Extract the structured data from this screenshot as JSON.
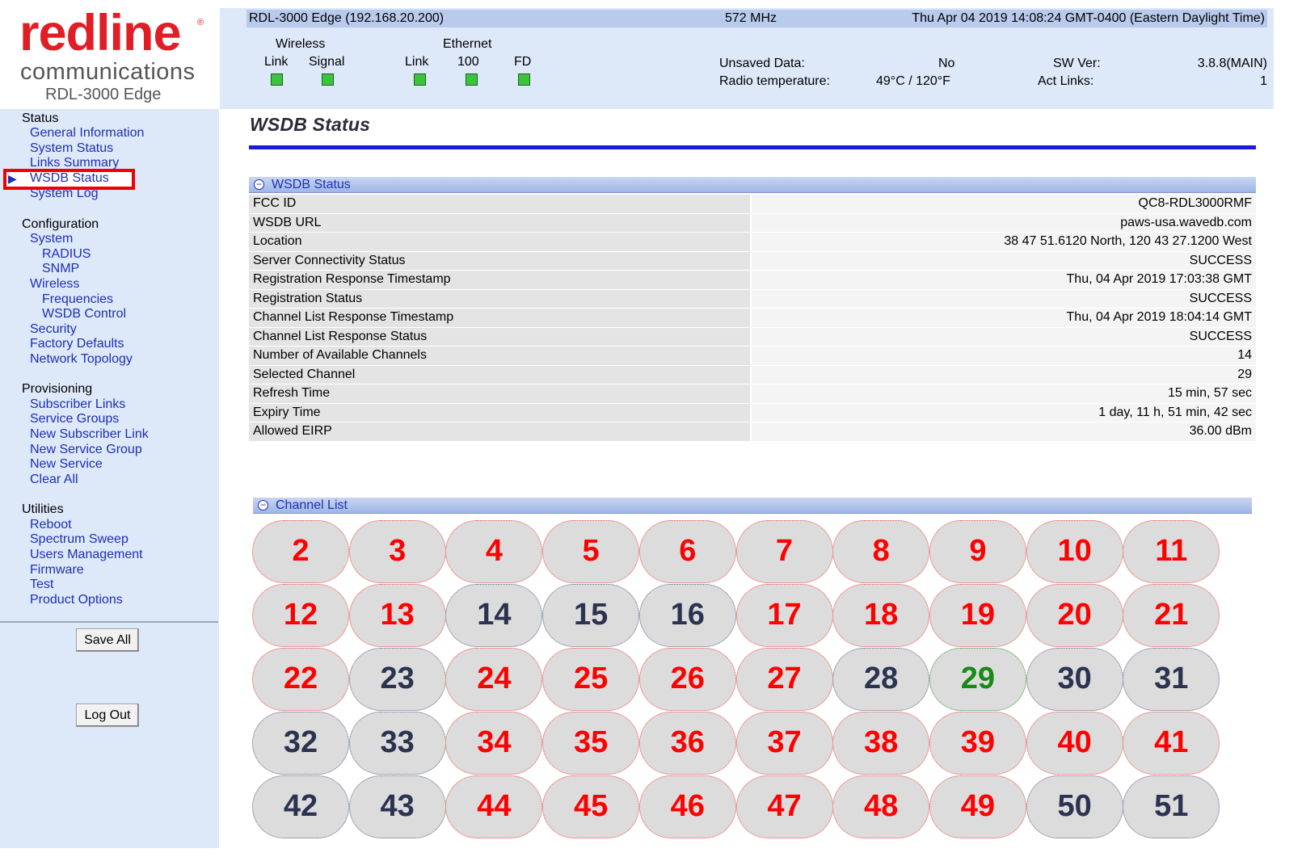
{
  "logo": {
    "word": "redline",
    "reg": "®",
    "sub": "communications",
    "model": "RDL-3000 Edge"
  },
  "header": {
    "device": "RDL-3000 Edge (192.168.20.200)",
    "frequency": "572 MHz",
    "datetime": "Thu Apr 04 2019 14:08:24 GMT-0400 (Eastern Daylight Time)",
    "wireless_label": "Wireless",
    "ethernet_label": "Ethernet",
    "leds": [
      "Link",
      "Signal",
      "Link",
      "100",
      "FD"
    ],
    "unsaved_label": "Unsaved Data:",
    "unsaved_value": "No",
    "temp_label": "Radio temperature:",
    "temp_value": "49°C / 120°F",
    "swver_label": "SW Ver:",
    "swver_value": "3.8.8(MAIN)",
    "actlinks_label": "Act Links:",
    "actlinks_value": "1",
    "led_color": "#3cc43c"
  },
  "nav": {
    "status": "Status",
    "general_info": "General Information",
    "system_status": "System Status",
    "links_summary": "Links Summary",
    "wsdb_status": "WSDB Status",
    "system_log": "System Log",
    "configuration": "Configuration",
    "system": "System",
    "radius": "RADIUS",
    "snmp": "SNMP",
    "wireless": "Wireless",
    "frequencies": "Frequencies",
    "wsdb_control": "WSDB Control",
    "security": "Security",
    "factory_defaults": "Factory Defaults",
    "network_topology": "Network Topology",
    "provisioning": "Provisioning",
    "subscriber_links": "Subscriber Links",
    "service_groups": "Service Groups",
    "new_subscriber_link": "New Subscriber Link",
    "new_service_group": "New Service Group",
    "new_service": "New Service",
    "clear_all": "Clear All",
    "utilities": "Utilities",
    "reboot": "Reboot",
    "spectrum_sweep": "Spectrum Sweep",
    "users_management": "Users Management",
    "firmware": "Firmware",
    "test": "Test",
    "product_options": "Product Options",
    "save_all": "Save All",
    "log_out": "Log Out",
    "active_marker": "▶",
    "active_border_color": "#f00000",
    "link_color": "#1d2fb8"
  },
  "main": {
    "title": "WSDB Status",
    "wsdb_panel_title": "WSDB Status",
    "toggle_symbol": "−",
    "rows": [
      {
        "key": "FCC ID",
        "value": "QC8-RDL3000RMF"
      },
      {
        "key": "WSDB URL",
        "value": "paws-usa.wavedb.com"
      },
      {
        "key": "Location",
        "value": "38 47 51.6120 North, 120 43 27.1200 West"
      },
      {
        "key": "Server Connectivity Status",
        "value": "SUCCESS"
      },
      {
        "key": "Registration Response Timestamp",
        "value": "Thu, 04 Apr 2019 17:03:38 GMT"
      },
      {
        "key": "Registration Status",
        "value": "SUCCESS"
      },
      {
        "key": "Channel List Response Timestamp",
        "value": "Thu, 04 Apr 2019 18:04:14 GMT"
      },
      {
        "key": "Channel List Response Status",
        "value": "SUCCESS"
      },
      {
        "key": "Number of Available Channels",
        "value": "14"
      },
      {
        "key": "Selected Channel",
        "value": "29"
      },
      {
        "key": "Refresh Time",
        "value": "15 min, 57 sec"
      },
      {
        "key": "Expiry Time",
        "value": "1 day, 11 h, 51 min, 42 sec"
      },
      {
        "key": "Allowed EIRP",
        "value": "36.00 dBm"
      }
    ],
    "channel_panel_title": "Channel List",
    "channels": [
      {
        "n": "2",
        "s": "unavail"
      },
      {
        "n": "3",
        "s": "unavail"
      },
      {
        "n": "4",
        "s": "unavail"
      },
      {
        "n": "5",
        "s": "unavail"
      },
      {
        "n": "6",
        "s": "unavail"
      },
      {
        "n": "7",
        "s": "unavail"
      },
      {
        "n": "8",
        "s": "unavail"
      },
      {
        "n": "9",
        "s": "unavail"
      },
      {
        "n": "10",
        "s": "unavail"
      },
      {
        "n": "11",
        "s": "unavail"
      },
      {
        "n": "12",
        "s": "unavail"
      },
      {
        "n": "13",
        "s": "unavail"
      },
      {
        "n": "14",
        "s": "avail"
      },
      {
        "n": "15",
        "s": "avail"
      },
      {
        "n": "16",
        "s": "avail"
      },
      {
        "n": "17",
        "s": "unavail"
      },
      {
        "n": "18",
        "s": "unavail"
      },
      {
        "n": "19",
        "s": "unavail"
      },
      {
        "n": "20",
        "s": "unavail"
      },
      {
        "n": "21",
        "s": "unavail"
      },
      {
        "n": "22",
        "s": "unavail"
      },
      {
        "n": "23",
        "s": "avail"
      },
      {
        "n": "24",
        "s": "unavail"
      },
      {
        "n": "25",
        "s": "unavail"
      },
      {
        "n": "26",
        "s": "unavail"
      },
      {
        "n": "27",
        "s": "unavail"
      },
      {
        "n": "28",
        "s": "avail"
      },
      {
        "n": "29",
        "s": "selected"
      },
      {
        "n": "30",
        "s": "avail"
      },
      {
        "n": "31",
        "s": "avail"
      },
      {
        "n": "32",
        "s": "avail"
      },
      {
        "n": "33",
        "s": "avail"
      },
      {
        "n": "34",
        "s": "unavail"
      },
      {
        "n": "35",
        "s": "unavail"
      },
      {
        "n": "36",
        "s": "unavail"
      },
      {
        "n": "37",
        "s": "unavail"
      },
      {
        "n": "38",
        "s": "unavail"
      },
      {
        "n": "39",
        "s": "unavail"
      },
      {
        "n": "40",
        "s": "unavail"
      },
      {
        "n": "41",
        "s": "unavail"
      },
      {
        "n": "42",
        "s": "avail"
      },
      {
        "n": "43",
        "s": "avail"
      },
      {
        "n": "44",
        "s": "unavail"
      },
      {
        "n": "45",
        "s": "unavail"
      },
      {
        "n": "46",
        "s": "unavail"
      },
      {
        "n": "47",
        "s": "unavail"
      },
      {
        "n": "48",
        "s": "unavail"
      },
      {
        "n": "49",
        "s": "unavail"
      },
      {
        "n": "50",
        "s": "avail"
      },
      {
        "n": "51",
        "s": "avail"
      }
    ],
    "colors": {
      "unavailable": "#ff0000",
      "available": "#2c3350",
      "selected": "#188a18",
      "title_rule": "#1a1adf"
    }
  }
}
